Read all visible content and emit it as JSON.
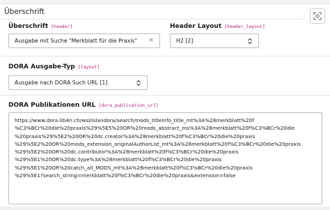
{
  "panel": {
    "title": "Überschrift"
  },
  "fields": {
    "header": {
      "label": "Überschrift",
      "key": "[header]",
      "value": "Ausgabe mit Suche \"Merkblatt für die Praxis\"",
      "clear_icon": "×"
    },
    "header_layout": {
      "label": "Header Layout",
      "key": "[header_layout]",
      "value": "H2 [2]"
    },
    "layout": {
      "label": "DORA Ausgabe-Typ",
      "key": "[layout]",
      "value": "Ausgabe nach DORA Such URL [1]"
    },
    "publication_url": {
      "label": "DORA Publikationen URL",
      "key": "[dora_publication_url]",
      "lines": [
        "https://www.dora.lib4ri.ch/wsl/islandora/search/mods_titleInfo_title_mt%3A%28merkblatt%20f",
        "%C3%BCr%20die%20praxis%29%5E5%20OR%20mods_abstract_ms%3A%28merkblatt%20f%C3%BCr%20die",
        "%20praxis%29%5E2%20OR%20dc.creator%3A%28merkblatt%20f%C3%BCr%20die%20praxis",
        "%29%5E2%20OR%20mods_extension_originalAuthorList_mt%3A%28merkblatt%20f%C3%BCr%20die%20praxis",
        "%29%5E2%20OR%20dc.contributor%3A%28merkblatt%20f%C3%BCr%20die%20praxis",
        "%29%5E1%20OR%20dc.type%3A%28merkblatt%20f%C3%BCr%20die%20praxis",
        "%29%5E1%20OR%20catch_all_MODS_mt%3A%28merkblatt%20f%C3%BCr%20die%20praxis",
        "%29%5E1?search_string=merkblatt%20f%C3%BCr%20die%20praxis&extension=false"
      ]
    }
  },
  "icons": {
    "side_button": "zoom-in-icon",
    "select_chevron": "chevron-up-down-icon"
  },
  "colors": {
    "field_key": "#b0207a",
    "border": "#bdbdbd"
  }
}
